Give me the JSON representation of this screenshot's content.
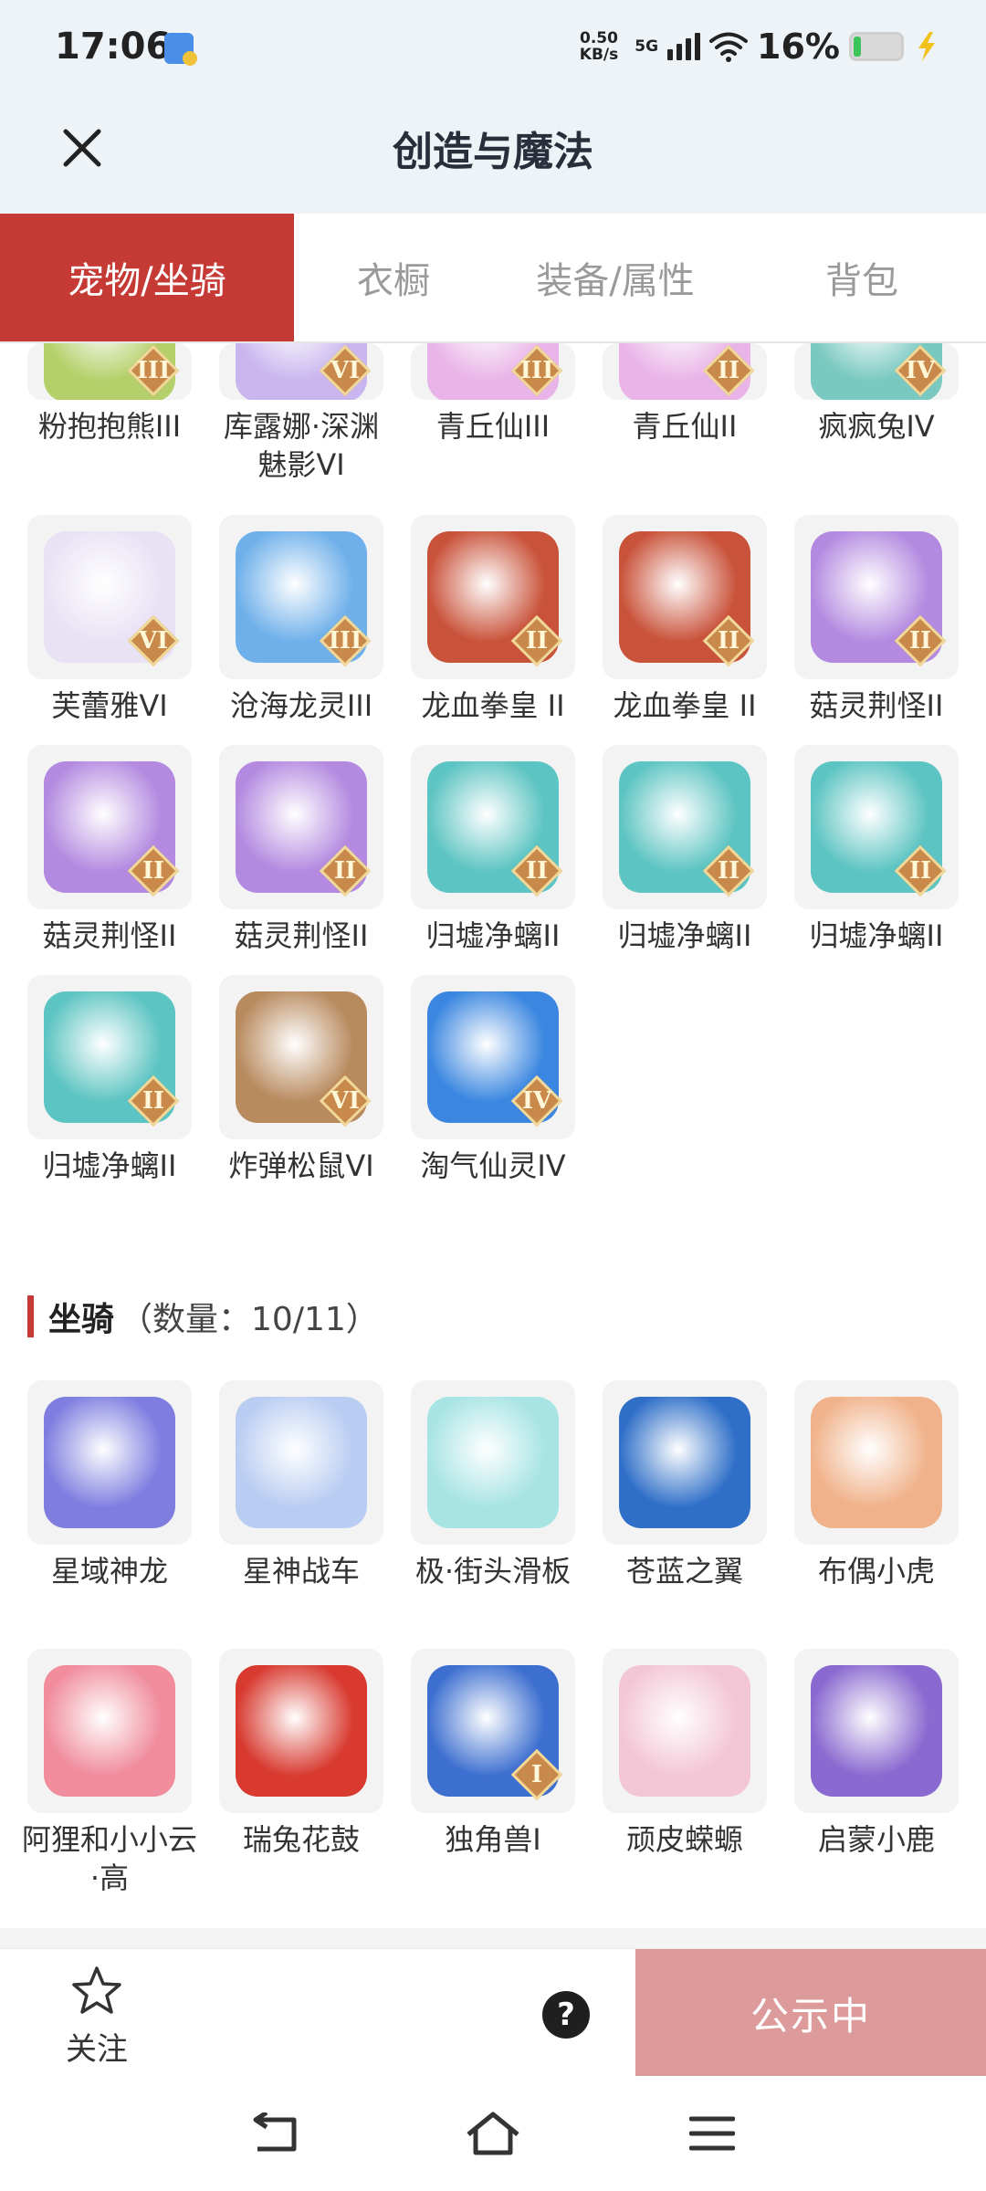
{
  "status_bar": {
    "time": "17:06",
    "net_speed_value": "0.50",
    "net_speed_unit": "KB/s",
    "network": "5G",
    "battery": "16%"
  },
  "header": {
    "title": "创造与魔法",
    "close_icon": "close-icon"
  },
  "tabs": [
    {
      "label": "宠物/坐骑",
      "active": true
    },
    {
      "label": "衣橱",
      "active": false
    },
    {
      "label": "装备/属性",
      "active": false
    },
    {
      "label": "背包",
      "active": false
    }
  ],
  "pets_partial_row": [
    {
      "name": "粉抱抱熊III",
      "rank": "III",
      "color": "#b5d06a"
    },
    {
      "name": "库露娜·深渊魅影VI",
      "rank": "VI",
      "color": "#c9b6ee"
    },
    {
      "name": "青丘仙III",
      "rank": "III",
      "color": "#e9b4e8"
    },
    {
      "name": "青丘仙II",
      "rank": "II",
      "color": "#e9b4e8"
    },
    {
      "name": "疯疯兔IV",
      "rank": "IV",
      "color": "#79c9c0"
    }
  ],
  "pets": [
    {
      "name": "芙蕾雅VI",
      "rank": "VI",
      "color": "#e9e2f4"
    },
    {
      "name": "沧海龙灵III",
      "rank": "III",
      "color": "#6fb0ea"
    },
    {
      "name": "龙血拳皇 II",
      "rank": "II",
      "color": "#c9523a"
    },
    {
      "name": "龙血拳皇 II",
      "rank": "II",
      "color": "#c9523a"
    },
    {
      "name": "菇灵荆怪II",
      "rank": "II",
      "color": "#b48ae0"
    },
    {
      "name": "菇灵荆怪II",
      "rank": "II",
      "color": "#b48ae0"
    },
    {
      "name": "菇灵荆怪II",
      "rank": "II",
      "color": "#b48ae0"
    },
    {
      "name": "归墟净螭II",
      "rank": "II",
      "color": "#5cc4c2"
    },
    {
      "name": "归墟净螭II",
      "rank": "II",
      "color": "#5cc4c2"
    },
    {
      "name": "归墟净螭II",
      "rank": "II",
      "color": "#5cc4c2"
    },
    {
      "name": "归墟净螭II",
      "rank": "II",
      "color": "#5cc4c2"
    },
    {
      "name": "炸弹松鼠VI",
      "rank": "VI",
      "color": "#b88a5e"
    },
    {
      "name": "淘气仙灵IV",
      "rank": "IV",
      "color": "#3a86e0"
    }
  ],
  "mounts_section": {
    "title": "坐骑",
    "count_text": "（数量：10/11）"
  },
  "mounts": [
    {
      "name": "星域神龙",
      "rank": "",
      "color": "#7f7ee0"
    },
    {
      "name": "星神战车",
      "rank": "",
      "color": "#b9cdf2"
    },
    {
      "name": "极·街头滑板",
      "rank": "",
      "color": "#a8e4e4"
    },
    {
      "name": "苍蓝之翼",
      "rank": "",
      "color": "#2f6fc8"
    },
    {
      "name": "布偶小虎",
      "rank": "",
      "color": "#f0b28a"
    },
    {
      "name": "阿狸和小小云·高",
      "rank": "",
      "color": "#f08c9c"
    },
    {
      "name": "瑞兔花鼓",
      "rank": "",
      "color": "#d83a30"
    },
    {
      "name": "独角兽I",
      "rank": "I",
      "color": "#3d6fd0"
    },
    {
      "name": "顽皮蝾螈",
      "rank": "",
      "color": "#f3c6d6"
    },
    {
      "name": "启蒙小鹿",
      "rank": "",
      "color": "#8a6ad0"
    }
  ],
  "action_bar": {
    "follow_label": "关注",
    "help": "?",
    "notice_label": "公示中"
  },
  "colors": {
    "accent": "#c53a35",
    "notice_button": "#dd9a9a",
    "header_bg": "#eef3f8"
  }
}
